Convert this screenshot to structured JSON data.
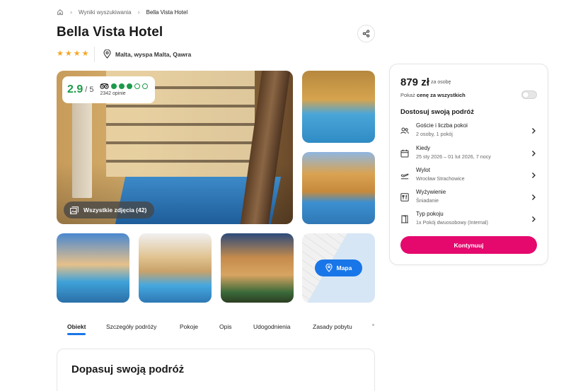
{
  "breadcrumb": {
    "home_icon": "home-icon",
    "items": [
      "Wyniki wyszukiwania",
      "Bella Vista Hotel"
    ]
  },
  "hotel": {
    "name": "Bella Vista Hotel",
    "stars": 4,
    "location": "Malta, wyspa Malta, Qawra",
    "rating": {
      "score": "2.9",
      "scale": "/ 5",
      "bubbles_filled": 3,
      "bubbles_total": 5,
      "reviews": "2342 opinie"
    },
    "all_photos_label": "Wszystkie zdjęcia (42)",
    "map_label": "Mapa"
  },
  "tabs": [
    {
      "label": "Obiekt",
      "active": true
    },
    {
      "label": "Szczegóły podróży",
      "active": false
    },
    {
      "label": "Pokoje",
      "active": false
    },
    {
      "label": "Opis",
      "active": false
    },
    {
      "label": "Udogodnienia",
      "active": false
    },
    {
      "label": "Zasady pobytu",
      "active": false
    }
  ],
  "section": {
    "title": "Dopasuj swoją podróż"
  },
  "booking": {
    "price": "879 zł",
    "per": "za osobę",
    "total_prefix": "Pokaż ",
    "total_bold": "cenę za wszystkich",
    "toggle_on": false,
    "heading": "Dostosuj swoją podróż",
    "options": [
      {
        "icon": "guests-icon",
        "label": "Goście i liczba pokoi",
        "value": "2 osoby, 1 pokój"
      },
      {
        "icon": "calendar-icon",
        "label": "Kiedy",
        "value": "25 sty 2026 – 01 lut 2026, 7 nocy"
      },
      {
        "icon": "plane-icon",
        "label": "Wylot",
        "value": "Wrocław Strachowice"
      },
      {
        "icon": "meal-icon",
        "label": "Wyżywienie",
        "value": "Śniadanie"
      },
      {
        "icon": "door-icon",
        "label": "Typ pokoju",
        "value": "1x Pokój dwuosobowy (Internal)"
      }
    ],
    "cta": "Kontynuuj"
  },
  "colors": {
    "accent": "#1976e8",
    "cta": "#e5096e",
    "rating": "#1e9a4a",
    "star": "#f5a623"
  }
}
